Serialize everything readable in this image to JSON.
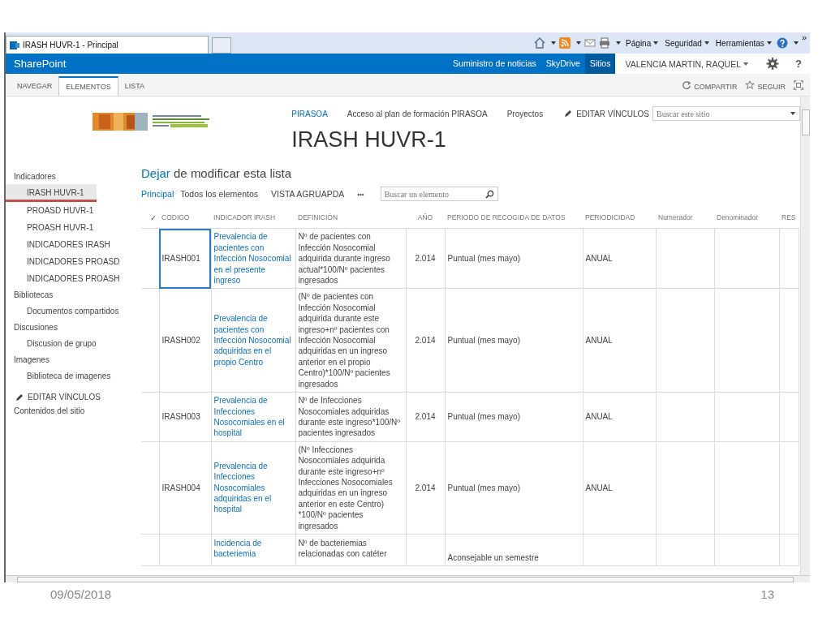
{
  "browser": {
    "tab": {
      "title": "IRASH HUVR-1 - Principal",
      "selected": true
    },
    "menus": [
      "Página",
      "Seguridad",
      "Herramientas"
    ],
    "more": "»"
  },
  "suite_bar": {
    "brand": "SharePoint",
    "links": [
      {
        "label": "Suministro de noticias",
        "selected": false
      },
      {
        "label": "SkyDrive",
        "selected": false
      },
      {
        "label": "Sitios",
        "selected": true
      }
    ],
    "user": "VALENCIA MARTIN, RAQUEL",
    "help": "?"
  },
  "ribbon": {
    "tabs": [
      {
        "label": "NAVEGAR",
        "selected": false
      },
      {
        "label": "ELEMENTOS",
        "selected": true
      },
      {
        "label": "LISTA",
        "selected": false
      }
    ],
    "actions": [
      "COMPARTIR",
      "SEGUIR"
    ]
  },
  "header": {
    "top_nav": [
      {
        "label": "PIRASOA",
        "selected": true
      },
      {
        "label": "Acceso al plan de formación PIRASOA",
        "selected": false
      },
      {
        "label": "Proyectos",
        "selected": false
      }
    ],
    "edit_links": "EDITAR VÍNCULOS",
    "search": {
      "placeholder": "Buscar este sitio"
    },
    "title": "IRASH HUVR-1"
  },
  "quick_launch": {
    "sections": [
      {
        "heading": "Indicadores",
        "items": [
          {
            "label": "IRASH HUVR-1",
            "selected": true
          },
          {
            "label": "PROASD HUVR-1",
            "selected": false
          },
          {
            "label": "PROASH HUVR-1",
            "selected": false
          },
          {
            "label": "INDICADORES IRASH",
            "selected": false
          },
          {
            "label": "INDICADORES PROASD",
            "selected": false
          },
          {
            "label": "INDICADORES PROASH",
            "selected": false
          }
        ]
      },
      {
        "heading": "Bibliotecas",
        "items": [
          {
            "label": "Documentos compartidos",
            "selected": false
          }
        ]
      },
      {
        "heading": "Discusiones",
        "items": [
          {
            "label": "Discusion de grupo",
            "selected": false
          }
        ]
      },
      {
        "heading": "Imagenes",
        "items": [
          {
            "label": "Biblioteca de imagenes",
            "selected": false
          }
        ]
      }
    ],
    "edit_links": "EDITAR VÍNCULOS",
    "site_contents": "Contenidos del sitio"
  },
  "list": {
    "edit_notice": {
      "link": "Dejar",
      "text": "de modificar esta lista"
    },
    "views": [
      {
        "label": "Principal",
        "selected": true
      },
      {
        "label": "Todos los elementos",
        "selected": false
      },
      {
        "label": "VISTA AGRUAPDA",
        "selected": false
      }
    ],
    "more": "•••",
    "search": {
      "placeholder": "Buscar un elemento"
    },
    "table": {
      "check_header": "✓",
      "columns": [
        "CODIGO",
        "INDICADOR IRASH",
        "DEFINICIÓN",
        "AÑO",
        "PERIODO DE RECOGIDA DE DATOS",
        "PERIODICIDAD",
        "Numerador",
        "Denominador",
        "RES"
      ],
      "rows": [
        {
          "code": "IRASH001",
          "indicator": "Prevalencia de pacientes con Infección Nosocomial en el presente ingreso",
          "definition": "Nº de pacientes con Infección Nosocomial adquirida durante ingreso actual*100/Nº pacientes ingresados",
          "year": "2.014",
          "period": "Puntual (mes mayo)",
          "periodicity": "ANUAL",
          "focused": true
        },
        {
          "code": "IRASH002",
          "indicator": "Prevalencia de pacientes con Infección Nosocomial adquiridas en el propio Centro",
          "definition": "(Nº de pacientes con Infección Nosocomial adquirida durante este ingreso+nº pacientes con Infección Nosocomial adquiridas en un ingreso anterior en el propio Centro)*100/Nº pacientes ingresados",
          "year": "2.014",
          "period": "Puntual (mes mayo)",
          "periodicity": "ANUAL",
          "focused": false
        },
        {
          "code": "IRASH003",
          "indicator": "Prevalencia de Infecciones Nosocomiales en el hospital",
          "definition": "Nº de Infecciones Nosocomiales adquiridas durante este ingreso*100/Nº pacientes ingresados",
          "year": "2.014",
          "period": "Puntual (mes mayo)",
          "periodicity": "ANUAL",
          "focused": false
        },
        {
          "code": "IRASH004",
          "indicator": "Prevalencia de Infecciones Nosocomiales adquiridas en el hospital",
          "definition": "(Nº Infecciones Nosocomiales adquirida durante este ingreso+nº Infecciones Nosocomiales adquiridas en un ingreso anterior en este Centro) *100/Nº pacientes ingresados",
          "year": "2.014",
          "period": "Puntual (mes mayo)",
          "periodicity": "ANUAL",
          "focused": false
        },
        {
          "indicator": "Incidencia de bacteriemia",
          "definition": "Nº de bacteriemias relacionadas con catéter",
          "period": "Aconsejable un semestre",
          "focused": false
        }
      ]
    }
  },
  "footer": {
    "date": "09/05/2018",
    "page": "13"
  }
}
